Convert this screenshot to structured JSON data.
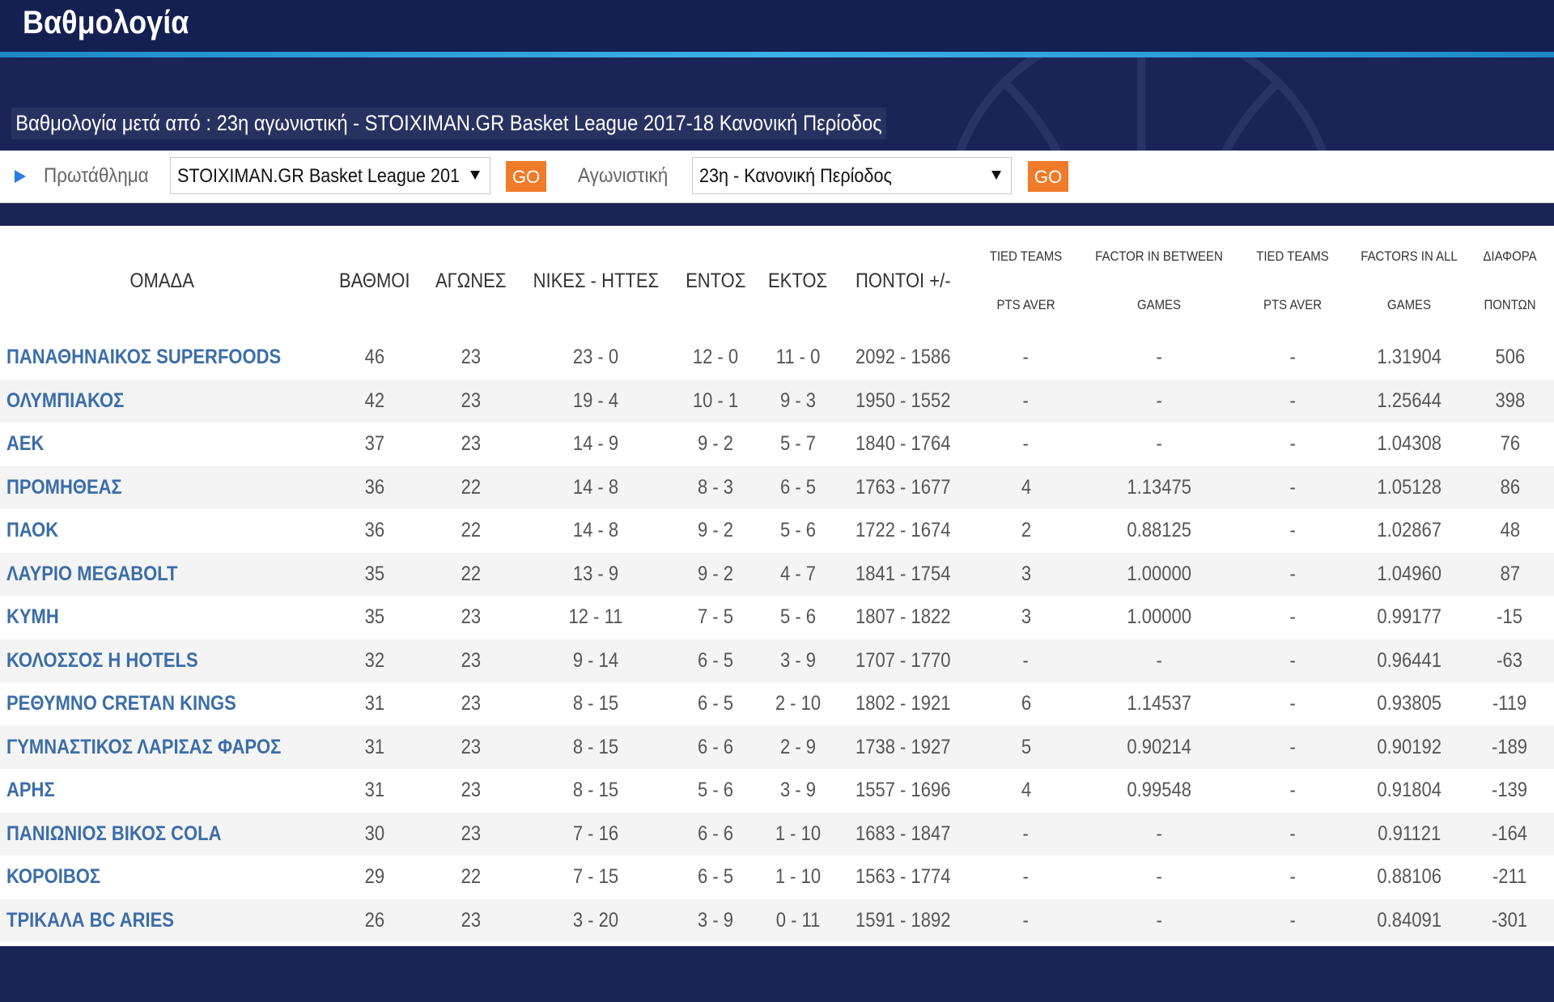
{
  "header": {
    "title": "Βαθμολογία"
  },
  "subtitle": "Βαθμολογία μετά από : 23η αγωνιστική - STOIXIMAN.GR Basket League 2017-18 Κανονική Περίοδος",
  "filters": {
    "championship_label": "Πρωτάθλημα",
    "championship_value": "STOIXIMAN.GR Basket League 201",
    "go_label": "GO",
    "round_label": "Αγωνιστική",
    "round_value": "23η - Κανονική Περίοδος",
    "go2_label": "GO"
  },
  "table": {
    "headers": {
      "team": "ΟΜΑΔΑ",
      "points": "ΒΑΘΜΟΙ",
      "games": "ΑΓΩΝΕΣ",
      "wl": "ΝΙΚΕΣ - ΗΤΤΕΣ",
      "home": "ΕΝΤΟΣ",
      "away": "ΕΚΤΟΣ",
      "score": "ΠΟΝΤΟΙ +/-",
      "tied1_a": "TIED TEAMS",
      "tied1_b": "PTS AVER",
      "factor_a": "FACTOR IN BETWEEN",
      "factor_b": "GAMES",
      "tied2_a": "TIED TEAMS",
      "tied2_b": "PTS AVER",
      "factors_a": "FACTORS IN ALL",
      "factors_b": "GAMES",
      "diff_a": "ΔΙΑΦΟΡΑ",
      "diff_b": "ΠΟΝΤΩΝ"
    },
    "rows": [
      [
        "ΠΑΝΑΘΗΝΑΙΚΟΣ SUPERFOODS",
        "46",
        "23",
        "23 - 0",
        "12 - 0",
        "11 - 0",
        "2092 - 1586",
        "-",
        "-",
        "-",
        "1.31904",
        "506"
      ],
      [
        "ΟΛΥΜΠΙΑΚΟΣ",
        "42",
        "23",
        "19 - 4",
        "10 - 1",
        "9 - 3",
        "1950 - 1552",
        "-",
        "-",
        "-",
        "1.25644",
        "398"
      ],
      [
        "ΑΕΚ",
        "37",
        "23",
        "14 - 9",
        "9 - 2",
        "5 - 7",
        "1840 - 1764",
        "-",
        "-",
        "-",
        "1.04308",
        "76"
      ],
      [
        "ΠΡΟΜΗΘΕΑΣ",
        "36",
        "22",
        "14 - 8",
        "8 - 3",
        "6 - 5",
        "1763 - 1677",
        "4",
        "1.13475",
        "-",
        "1.05128",
        "86"
      ],
      [
        "ΠΑΟΚ",
        "36",
        "22",
        "14 - 8",
        "9 - 2",
        "5 - 6",
        "1722 - 1674",
        "2",
        "0.88125",
        "-",
        "1.02867",
        "48"
      ],
      [
        "ΛΑΥΡΙΟ MEGABOLT",
        "35",
        "22",
        "13 - 9",
        "9 - 2",
        "4 - 7",
        "1841 - 1754",
        "3",
        "1.00000",
        "-",
        "1.04960",
        "87"
      ],
      [
        "ΚΥΜΗ",
        "35",
        "23",
        "12 - 11",
        "7 - 5",
        "5 - 6",
        "1807 - 1822",
        "3",
        "1.00000",
        "-",
        "0.99177",
        "-15"
      ],
      [
        "ΚΟΛΟΣΣΟΣ H HOTELS",
        "32",
        "23",
        "9 - 14",
        "6 - 5",
        "3 - 9",
        "1707 - 1770",
        "-",
        "-",
        "-",
        "0.96441",
        "-63"
      ],
      [
        "ΡΕΘΥΜΝΟ CRETAN KINGS",
        "31",
        "23",
        "8 - 15",
        "6 - 5",
        "2 - 10",
        "1802 - 1921",
        "6",
        "1.14537",
        "-",
        "0.93805",
        "-119"
      ],
      [
        "ΓΥΜΝΑΣΤΙΚΟΣ ΛΑΡΙΣΑΣ ΦΑΡΟΣ",
        "31",
        "23",
        "8 - 15",
        "6 - 6",
        "2 - 9",
        "1738 - 1927",
        "5",
        "0.90214",
        "-",
        "0.90192",
        "-189"
      ],
      [
        "ΑΡΗΣ",
        "31",
        "23",
        "8 - 15",
        "5 - 6",
        "3 - 9",
        "1557 - 1696",
        "4",
        "0.99548",
        "-",
        "0.91804",
        "-139"
      ],
      [
        "ΠΑΝΙΩΝΙΟΣ ΒΙΚΟΣ COLA",
        "30",
        "23",
        "7 - 16",
        "6 - 6",
        "1 - 10",
        "1683 - 1847",
        "-",
        "-",
        "-",
        "0.91121",
        "-164"
      ],
      [
        "ΚΟΡΟΙΒΟΣ",
        "29",
        "22",
        "7 - 15",
        "6 - 5",
        "1 - 10",
        "1563 - 1774",
        "-",
        "-",
        "-",
        "0.88106",
        "-211"
      ],
      [
        "ΤΡΙΚΑΛΑ BC ARIES",
        "26",
        "23",
        "3 - 20",
        "3 - 9",
        "0 - 11",
        "1591 - 1892",
        "-",
        "-",
        "-",
        "0.84091",
        "-301"
      ]
    ]
  },
  "colors": {
    "navy": "#1b2456",
    "accent_line": "#3fb0e8",
    "go_button": "#f07b2a",
    "team_link": "#3b6da8"
  }
}
